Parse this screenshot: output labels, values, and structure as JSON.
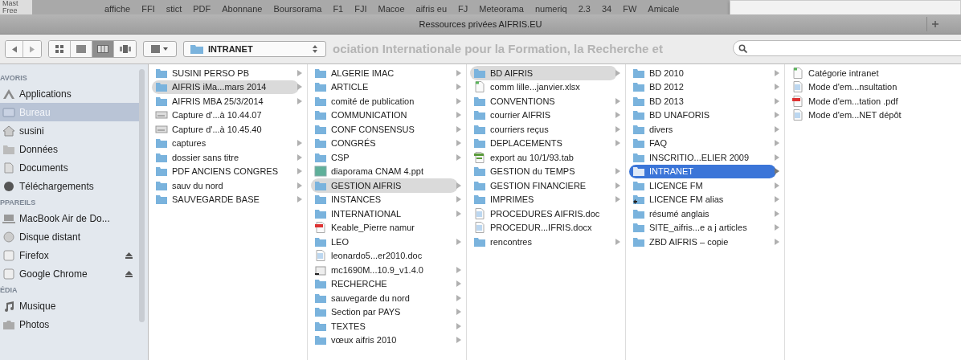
{
  "background_window": {
    "edge_tabs": [
      "Mast",
      "Free"
    ],
    "bookmarks": [
      "affiche",
      "FFI",
      "stict",
      "PDF",
      "Abonnane",
      "Boursorama",
      "F1",
      "FJI",
      "Macoe",
      "aifris eu",
      "FJ",
      "Meteorama",
      "numeriq",
      "2.3",
      "34",
      "FW",
      "Amicale"
    ],
    "page_heading": "ociation Internationale pour la Formation, la Recherche et"
  },
  "window": {
    "title": "Ressources privées AIFRIS.EU"
  },
  "toolbar": {
    "view_buttons": [
      {
        "kind": "icons",
        "selected": false
      },
      {
        "kind": "list",
        "selected": false
      },
      {
        "kind": "columns",
        "selected": true
      },
      {
        "kind": "coverflow",
        "selected": false
      }
    ],
    "path_popup": "INTRANET"
  },
  "sidebar": {
    "sections": [
      {
        "heading": "AVORIS",
        "items": [
          {
            "label": "Applications",
            "kind": "apps",
            "selected": false,
            "ejectable": false
          },
          {
            "label": "Bureau",
            "kind": "desktop",
            "selected": true,
            "ejectable": false
          },
          {
            "label": "susini",
            "kind": "home",
            "selected": false,
            "ejectable": false
          },
          {
            "label": "Données",
            "kind": "folder",
            "selected": false,
            "ejectable": false
          },
          {
            "label": "Documents",
            "kind": "docs",
            "selected": false,
            "ejectable": false
          },
          {
            "label": "Téléchargements",
            "kind": "download",
            "selected": false,
            "ejectable": false
          }
        ]
      },
      {
        "heading": "PPAREILS",
        "items": [
          {
            "label": "MacBook Air de Do...",
            "kind": "laptop",
            "selected": false,
            "ejectable": false
          },
          {
            "label": "Disque distant",
            "kind": "disc",
            "selected": false,
            "ejectable": false
          },
          {
            "label": "Firefox",
            "kind": "drive",
            "selected": false,
            "ejectable": true
          },
          {
            "label": "Google Chrome",
            "kind": "drive",
            "selected": false,
            "ejectable": true
          }
        ]
      },
      {
        "heading": "ÉDIA",
        "items": [
          {
            "label": "Musique",
            "kind": "music",
            "selected": false,
            "ejectable": false
          },
          {
            "label": "Photos",
            "kind": "camera",
            "selected": false,
            "ejectable": false
          }
        ]
      }
    ]
  },
  "columns": [
    {
      "items": [
        {
          "label": "SUSINI PERSO PB",
          "kind": "folder",
          "selected": false
        },
        {
          "label": "AIFRIS iMa...mars 2014",
          "kind": "folder",
          "selected": true
        },
        {
          "label": "AIFRIS MBA 25/3/2014",
          "kind": "folder",
          "selected": false
        },
        {
          "label": "Capture d'...à 10.44.07",
          "kind": "image",
          "selected": false
        },
        {
          "label": "Capture d'...à 10.45.40",
          "kind": "image",
          "selected": false
        },
        {
          "label": "captures",
          "kind": "folder",
          "selected": false
        },
        {
          "label": "dossier sans titre",
          "kind": "folder",
          "selected": false
        },
        {
          "label": "PDF ANCIENS CONGRES",
          "kind": "folder",
          "selected": false
        },
        {
          "label": "sauv du nord",
          "kind": "folder",
          "selected": false
        },
        {
          "label": "SAUVEGARDE BASE",
          "kind": "folder",
          "selected": false
        }
      ]
    },
    {
      "items": [
        {
          "label": "ALGERIE IMAC",
          "kind": "folder",
          "selected": false
        },
        {
          "label": "ARTICLE",
          "kind": "folder",
          "selected": false
        },
        {
          "label": "comité de publication",
          "kind": "folder",
          "selected": false
        },
        {
          "label": "COMMUNICATION",
          "kind": "folder",
          "selected": false
        },
        {
          "label": "CONF CONSENSUS",
          "kind": "folder",
          "selected": false
        },
        {
          "label": "CONGRÉS",
          "kind": "folder",
          "selected": false
        },
        {
          "label": "CSP",
          "kind": "folder",
          "selected": false
        },
        {
          "label": "diaporama CNAM 4.ppt",
          "kind": "slides",
          "selected": false
        },
        {
          "label": "GESTION AIFRIS",
          "kind": "folder",
          "selected": true
        },
        {
          "label": "INSTANCES",
          "kind": "folder",
          "selected": false
        },
        {
          "label": "INTERNATIONAL",
          "kind": "folder",
          "selected": false
        },
        {
          "label": "Keable_Pierre namur",
          "kind": "pdf",
          "selected": false
        },
        {
          "label": "LEO",
          "kind": "folder",
          "selected": false
        },
        {
          "label": "leonardo5...er2010.doc",
          "kind": "doc",
          "selected": false
        },
        {
          "label": "mc1690M...10.9_v1.4.0",
          "kind": "package",
          "selected": false
        },
        {
          "label": "RECHERCHE",
          "kind": "folder",
          "selected": false
        },
        {
          "label": "sauvegarde du nord",
          "kind": "folder",
          "selected": false
        },
        {
          "label": "Section par PAYS",
          "kind": "folder",
          "selected": false
        },
        {
          "label": "TEXTES",
          "kind": "folder",
          "selected": false
        },
        {
          "label": "vœux aifris 2010",
          "kind": "folder",
          "selected": false
        }
      ]
    },
    {
      "items": [
        {
          "label": "BD AIFRIS",
          "kind": "folder",
          "selected": true
        },
        {
          "label": "comm lille...janvier.xlsx",
          "kind": "sheet",
          "selected": false
        },
        {
          "label": "CONVENTIONS",
          "kind": "folder",
          "selected": false
        },
        {
          "label": "courrier AIFRIS",
          "kind": "folder",
          "selected": false
        },
        {
          "label": "courriers reçus",
          "kind": "folder",
          "selected": false
        },
        {
          "label": "DEPLACEMENTS",
          "kind": "folder",
          "selected": false
        },
        {
          "label": "export au 10/1/93.tab",
          "kind": "table",
          "selected": false
        },
        {
          "label": "GESTION du TEMPS",
          "kind": "folder",
          "selected": false
        },
        {
          "label": "GESTION FINANCIERE",
          "kind": "folder",
          "selected": false
        },
        {
          "label": "IMPRIMES",
          "kind": "folder",
          "selected": false
        },
        {
          "label": "PROCEDURES  AIFRIS.doc",
          "kind": "doc",
          "selected": false
        },
        {
          "label": "PROCEDUR...IFRIS.docx",
          "kind": "doc",
          "selected": false
        },
        {
          "label": "rencontres",
          "kind": "folder",
          "selected": false
        }
      ]
    },
    {
      "items": [
        {
          "label": "BD 2010",
          "kind": "folder",
          "selected": false
        },
        {
          "label": "BD 2012",
          "kind": "folder",
          "selected": false
        },
        {
          "label": "BD 2013",
          "kind": "folder",
          "selected": false
        },
        {
          "label": "BD UNAFORIS",
          "kind": "folder",
          "selected": false
        },
        {
          "label": "divers",
          "kind": "folder",
          "selected": false
        },
        {
          "label": "FAQ",
          "kind": "folder",
          "selected": false
        },
        {
          "label": "INSCRITIO...ELIER 2009",
          "kind": "folder",
          "selected": false
        },
        {
          "label": "INTRANET",
          "kind": "folder",
          "selected": true
        },
        {
          "label": "LICENCE FM",
          "kind": "folder",
          "selected": false
        },
        {
          "label": "LICENCE FM alias",
          "kind": "alias",
          "selected": false
        },
        {
          "label": "résumé anglais",
          "kind": "folder",
          "selected": false
        },
        {
          "label": "SITE_aifris...e a j articles",
          "kind": "folder",
          "selected": false
        },
        {
          "label": "ZBD AIFRIS – copie",
          "kind": "folder",
          "selected": false
        }
      ]
    },
    {
      "items": [
        {
          "label": "Catégorie intranet",
          "kind": "sheet",
          "selected": false
        },
        {
          "label": "Mode d'em...nsultation",
          "kind": "doc",
          "selected": false
        },
        {
          "label": "Mode d'em...tation .pdf",
          "kind": "pdf",
          "selected": false
        },
        {
          "label": "Mode d'em...NET dépôt",
          "kind": "doc",
          "selected": false
        }
      ]
    }
  ]
}
